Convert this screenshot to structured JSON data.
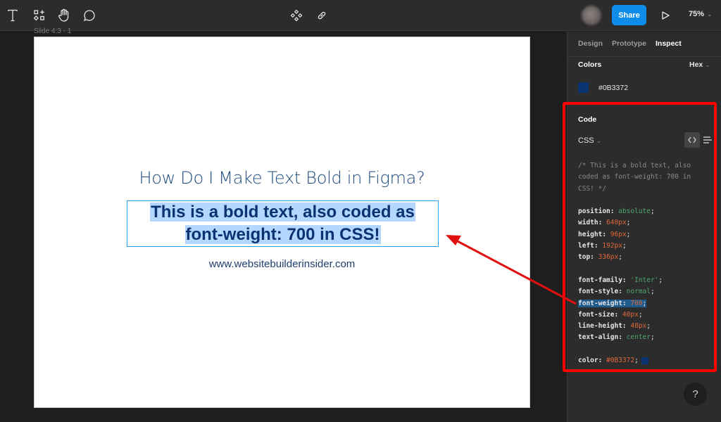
{
  "toolbar": {
    "left_icons": [
      "text-tool-icon",
      "shapes-tool-icon",
      "hand-tool-icon",
      "comment-tool-icon"
    ],
    "center_icons": [
      "components-icon",
      "link-icon"
    ],
    "share_label": "Share",
    "zoom_level": "75%"
  },
  "canvas": {
    "frame_label": "Slide 4:3 - 1",
    "slide": {
      "heading": "How Do I Make Text Bold in Figma?",
      "bold_line_1": "This is a bold text, also coded as",
      "bold_line_2": "font-weight: 700 in CSS!",
      "url": "www.websitebuilderinsider.com"
    }
  },
  "panel": {
    "tabs": [
      {
        "label": "Design",
        "active": false
      },
      {
        "label": "Prototype",
        "active": false
      },
      {
        "label": "Inspect",
        "active": true
      }
    ],
    "colors": {
      "title": "Colors",
      "format": "Hex",
      "items": [
        {
          "hex": "#0B3372",
          "swatch": "#0B3372"
        }
      ]
    },
    "code": {
      "title": "Code",
      "language": "CSS",
      "comment_lines": [
        "/* This is a bold text, also",
        "coded as font-weight: 700 in",
        "CSS! */"
      ],
      "properties": [
        {
          "prop": "position",
          "value": "absolute",
          "type": "kw"
        },
        {
          "prop": "width",
          "value": "640px",
          "type": "num"
        },
        {
          "prop": "height",
          "value": "96px",
          "type": "num"
        },
        {
          "prop": "left",
          "value": "192px",
          "type": "num"
        },
        {
          "prop": "top",
          "value": "336px",
          "type": "num"
        },
        {
          "prop": "font-family",
          "value": "'Inter'",
          "type": "str"
        },
        {
          "prop": "font-style",
          "value": "normal",
          "type": "kw"
        },
        {
          "prop": "font-weight",
          "value": "700",
          "type": "num"
        },
        {
          "prop": "font-size",
          "value": "40px",
          "type": "num"
        },
        {
          "prop": "line-height",
          "value": "48px",
          "type": "num"
        },
        {
          "prop": "text-align",
          "value": "center",
          "type": "kw"
        },
        {
          "prop": "color",
          "value": "#0B3372",
          "type": "num"
        }
      ]
    }
  },
  "help_label": "?",
  "colors": {
    "accent": "#0d8ce9",
    "annotation": "#ff0000",
    "text_color": "#0B3372",
    "selection": "#b3d7ff"
  }
}
